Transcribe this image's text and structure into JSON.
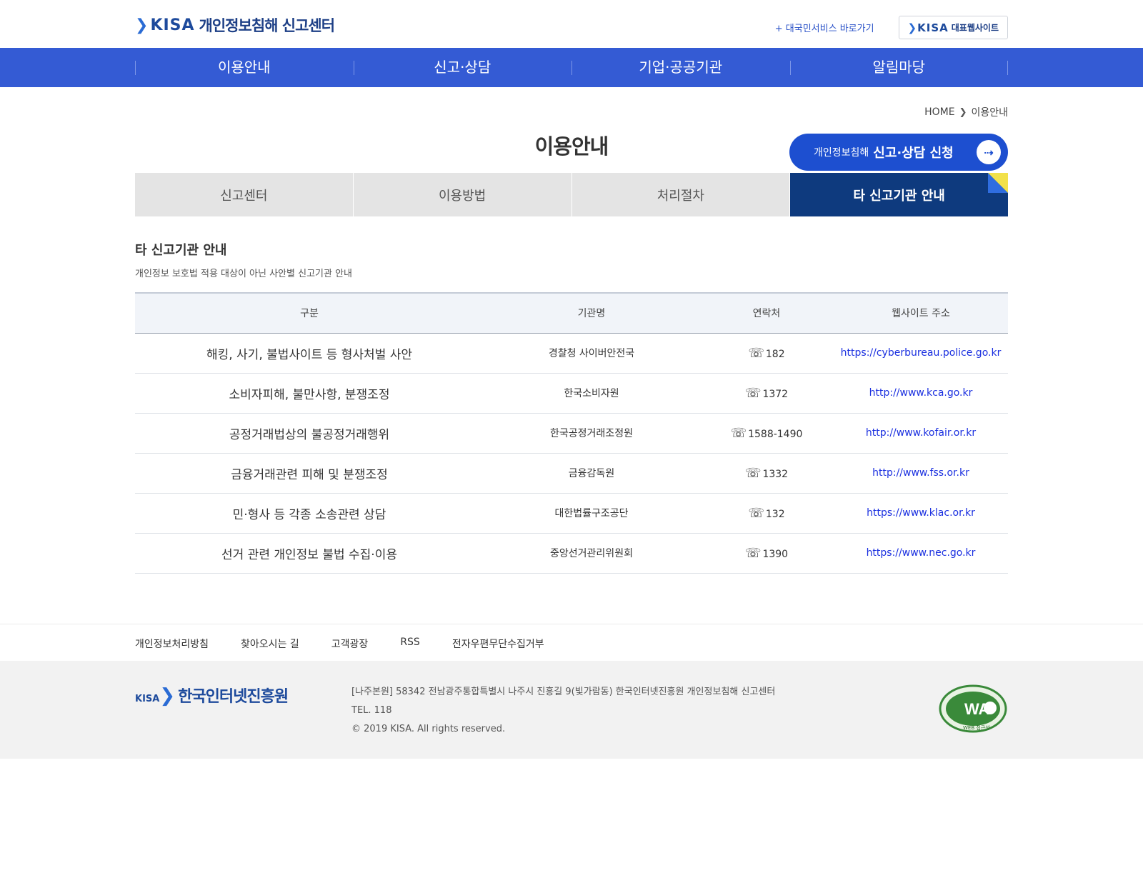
{
  "header": {
    "logo_mark": "KISA",
    "logo_title": "개인정보침해 신고센터",
    "quick_link": "+ 대국민서비스 바로가기",
    "site_button": "대표웹사이트",
    "site_button_mark": "KISA"
  },
  "gnb": [
    "이용안내",
    "신고·상담",
    "기업·공공기관",
    "알림마당"
  ],
  "breadcrumb": {
    "home": "HOME",
    "current": "이용안내"
  },
  "page_title": "이용안내",
  "apply_button": {
    "small": "개인정보침해",
    "big": "신고·상담 신청"
  },
  "tabs": [
    "신고센터",
    "이용방법",
    "처리절차",
    "타 신고기관 안내"
  ],
  "section": {
    "title": "타 신고기관 안내",
    "desc": "개인정보 보호법 적용 대상이 아닌 사안별 신고기관 안내"
  },
  "table": {
    "headers": [
      "구분",
      "기관명",
      "연락처",
      "웹사이트 주소"
    ],
    "rows": [
      {
        "category": "해킹, 사기, 불법사이트 등 형사처벌 사안",
        "org": "경찰청 사이버안전국",
        "phone": "182",
        "url": "https://cyberbureau.police.go.kr"
      },
      {
        "category": "소비자피해, 불만사항, 분쟁조정",
        "org": "한국소비자원",
        "phone": "1372",
        "url": "http://www.kca.go.kr"
      },
      {
        "category": "공정거래법상의 불공정거래행위",
        "org": "한국공정거래조정원",
        "phone": "1588-1490",
        "url": "http://www.kofair.or.kr"
      },
      {
        "category": "금융거래관련 피해 및 분쟁조정",
        "org": "금융감독원",
        "phone": "1332",
        "url": "http://www.fss.or.kr"
      },
      {
        "category": "민·형사 등 각종 소송관련 상담",
        "org": "대한법률구조공단",
        "phone": "132",
        "url": "https://www.klac.or.kr"
      },
      {
        "category": "선거 관련 개인정보 불법 수집·이용",
        "org": "중앙선거관리위원회",
        "phone": "1390",
        "url": "https://www.nec.go.kr"
      }
    ]
  },
  "footer_links": [
    "개인정보처리방침",
    "찾아오시는 길",
    "고객광장",
    "RSS",
    "전자우편무단수집거부"
  ],
  "footer": {
    "logo_mark": "KISA",
    "logo_name": "한국인터넷진흥원",
    "address": "[나주본원] 58342 전남광주통합특별시 나주시 진흥길 9(빛가람동) 한국인터넷진흥원 개인정보침해 신고센터",
    "tel": "TEL. 118",
    "copyright": "© 2019 KISA. All rights reserved.",
    "badge_text": "WA",
    "badge_caption": "WEB 접근성"
  },
  "colors": {
    "gnb": "#345bd4",
    "active_tab": "#0e3a7e",
    "apply_button": "#1d4fd0",
    "link": "#1a2fe0"
  },
  "icons": {
    "phone": "phone-icon",
    "apply_arrow": "arrow-circle-icon",
    "breadcrumb_sep": "chevron-right-icon"
  }
}
